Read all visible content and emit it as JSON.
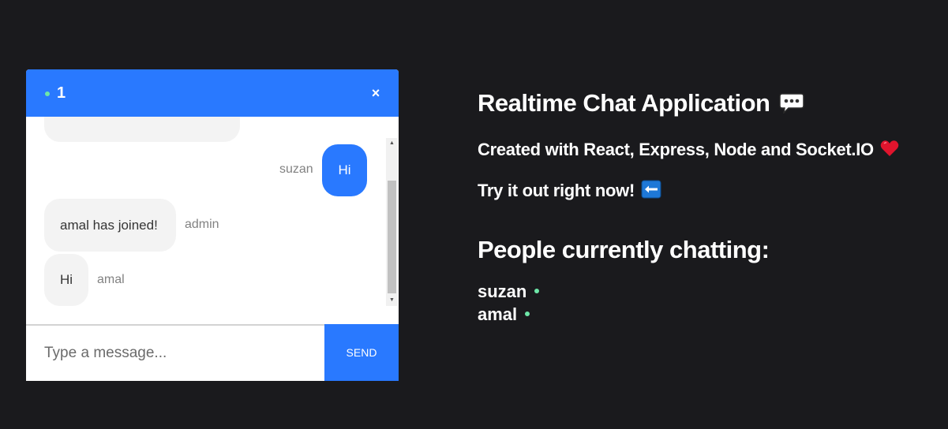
{
  "chat": {
    "room_name": "1",
    "close_label": "×",
    "messages": [
      {
        "text": "Hi",
        "sender": "suzan",
        "mine": true
      },
      {
        "text": "amal has joined!",
        "sender": "admin",
        "mine": false
      },
      {
        "text": "Hi",
        "sender": "amal",
        "mine": false
      }
    ],
    "input_placeholder": "Type a message...",
    "input_value": "",
    "send_label": "SEND"
  },
  "info": {
    "title": "Realtime Chat Application",
    "subtitle": "Created with React, Express, Node and Socket.IO",
    "cta": "Try it out right now!",
    "people_heading": "People currently chatting:",
    "users": [
      "suzan",
      "amal"
    ]
  },
  "icons": {
    "title_icon": "speech-balloon-icon",
    "subtitle_icon": "red-heart-icon",
    "cta_icon": "left-arrow-icon",
    "online_indicator": "online-dot-icon"
  },
  "colors": {
    "background": "#1a1a1d",
    "accent": "#2979ff",
    "online": "#6ee7a8",
    "bubble_other": "#f3f3f3"
  }
}
